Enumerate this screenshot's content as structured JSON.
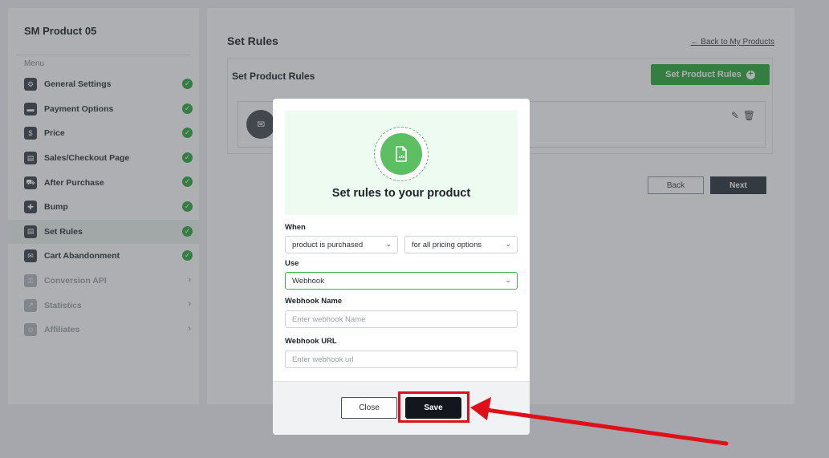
{
  "sidebar": {
    "title": "SM Product 05",
    "menu_label": "Menu",
    "items": [
      {
        "label": "General Settings",
        "icon": "gear-icon",
        "glyph": "⚙",
        "state": "done"
      },
      {
        "label": "Payment Options",
        "icon": "card-icon",
        "glyph": "▬",
        "state": "done"
      },
      {
        "label": "Price",
        "icon": "dollar-icon",
        "glyph": "$",
        "state": "done"
      },
      {
        "label": "Sales/Checkout Page",
        "icon": "page-icon",
        "glyph": "▤",
        "state": "done"
      },
      {
        "label": "After Purchase",
        "icon": "truck-icon",
        "glyph": "⛟",
        "state": "done"
      },
      {
        "label": "Bump",
        "icon": "gift-icon",
        "glyph": "✚",
        "state": "done"
      },
      {
        "label": "Set Rules",
        "icon": "document-icon",
        "glyph": "▤",
        "state": "done"
      },
      {
        "label": "Cart Abandonment",
        "icon": "envelope-icon",
        "glyph": "✉",
        "state": "done"
      },
      {
        "label": "Conversion API",
        "icon": "key-icon",
        "glyph": "⚿",
        "state": "locked"
      },
      {
        "label": "Statistics",
        "icon": "chart-icon",
        "glyph": "↗",
        "state": "locked"
      },
      {
        "label": "Affiliates",
        "icon": "users-icon",
        "glyph": "☺",
        "state": "locked"
      }
    ]
  },
  "main": {
    "title": "Set Rules",
    "back_link": "← Back to My Products",
    "card_title": "Set Product Rules",
    "set_rules_button": "Set Product Rules",
    "back_button": "Back",
    "next_button": "Next"
  },
  "modal": {
    "heading": "Set rules to your product",
    "when_label": "When",
    "when_value": "product is purchased",
    "pricing_value": "for all pricing options",
    "use_label": "Use",
    "use_value": "Webhook",
    "webhook_name_label": "Webhook Name",
    "webhook_name_placeholder": "Enter webhook Name",
    "webhook_url_label": "Webhook URL",
    "webhook_url_placeholder": "Enter webhook url",
    "close_button": "Close",
    "save_button": "Save"
  },
  "colors": {
    "accent_green": "#3cb14a",
    "save_dark": "#14161d",
    "annotation_red": "#e0101a"
  }
}
